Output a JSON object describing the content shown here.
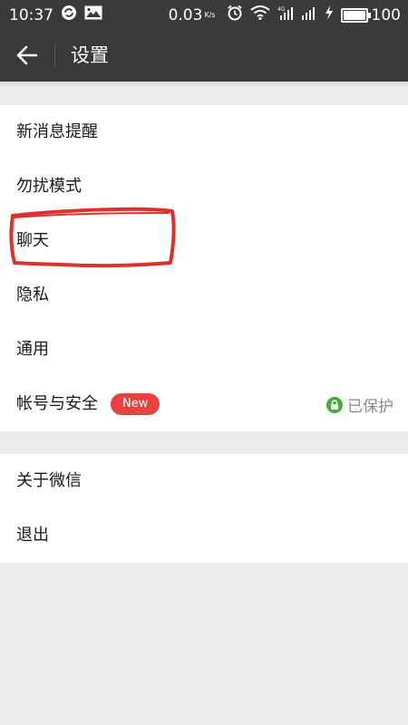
{
  "status_bar": {
    "time": "10:37",
    "net_speed": "0.03",
    "net_unit": "K/s",
    "battery": "100"
  },
  "app_bar": {
    "title": "设置",
    "back_icon": "arrow-left-icon"
  },
  "settings": {
    "group1": [
      {
        "label": "新消息提醒"
      },
      {
        "label": "勿扰模式"
      },
      {
        "label": "聊天"
      },
      {
        "label": "隐私"
      },
      {
        "label": "通用"
      },
      {
        "label": "帐号与安全",
        "badge": "New",
        "status": "已保护",
        "status_icon": "lock-icon"
      }
    ],
    "group2": [
      {
        "label": "关于微信"
      },
      {
        "label": "退出"
      }
    ]
  },
  "colors": {
    "header_bg": "#393939",
    "page_bg": "#ebebeb",
    "badge_red": "#e64340",
    "lock_green": "#3cb034",
    "annotation_red": "#e0302a"
  }
}
